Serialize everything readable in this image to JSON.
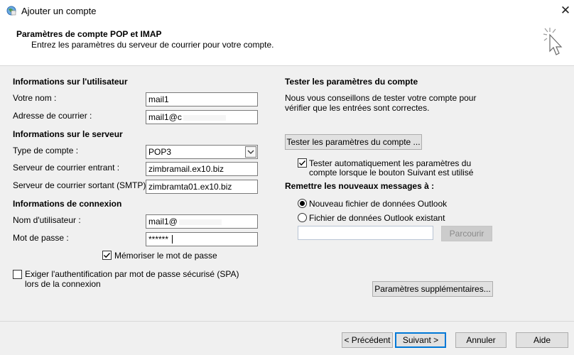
{
  "window": {
    "title": "Ajouter un compte",
    "close_glyph": "✕"
  },
  "header": {
    "title": "Paramètres de compte POP et IMAP",
    "subtitle": "Entrez les paramètres du serveur de courrier pour votre compte."
  },
  "user_info": {
    "heading": "Informations sur l'utilisateur",
    "name_label": "Votre nom :",
    "name_value": "mail1",
    "email_label": "Adresse de courrier :",
    "email_value": "mail1@c"
  },
  "server_info": {
    "heading": "Informations sur le serveur",
    "account_type_label": "Type de compte :",
    "account_type_value": "POP3",
    "incoming_label": "Serveur de courrier entrant :",
    "incoming_value": "zimbramail.ex10.biz",
    "outgoing_label": "Serveur de courrier sortant (SMTP) :",
    "outgoing_value": "zimbramta01.ex10.biz"
  },
  "login_info": {
    "heading": "Informations de connexion",
    "username_label": "Nom d'utilisateur :",
    "username_value": "mail1@",
    "password_label": "Mot de passe :",
    "password_value": "******",
    "remember_label": "Mémoriser le mot de passe",
    "remember_checked": true,
    "spa_label_line1": "Exiger l'authentification par mot de passe sécurisé (SPA)",
    "spa_label_line2": "lors de la connexion",
    "spa_checked": false
  },
  "test": {
    "heading": "Tester les paramètres du compte",
    "description_line1": "Nous vous conseillons de tester votre compte pour",
    "description_line2": "vérifier que les entrées sont correctes.",
    "test_button": "Tester les paramètres du compte ...",
    "auto_test_line1": "Tester automatiquement les paramètres du",
    "auto_test_line2": "compte lorsque le bouton Suivant est utilisé",
    "auto_test_checked": true
  },
  "deliver": {
    "heading": "Remettre les nouveaux messages à :",
    "option_new": "Nouveau fichier de données Outlook",
    "option_existing": "Fichier de données Outlook existant",
    "selected": "new",
    "existing_path": "",
    "browse_button": "Parcourir"
  },
  "more_settings_button": "Paramètres supplémentaires...",
  "footer": {
    "back": "< Précédent",
    "next": "Suivant >",
    "cancel": "Annuler",
    "help": "Aide"
  },
  "colors": {
    "accent": "#0078d7",
    "button_bg": "#e1e1e1",
    "window_bg": "#f0f0f0"
  }
}
